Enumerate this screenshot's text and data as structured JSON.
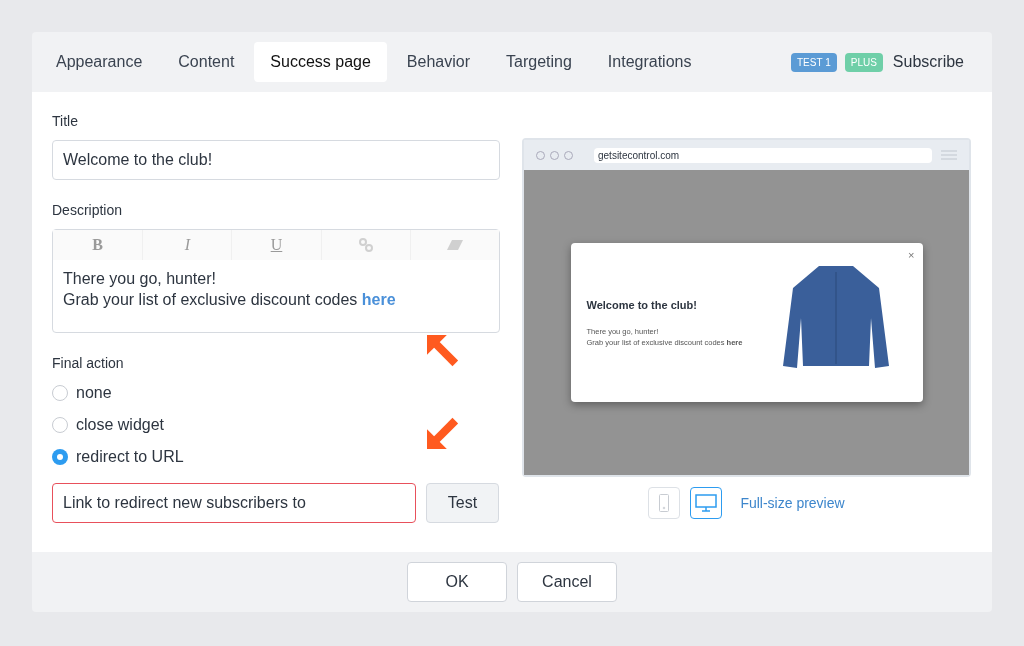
{
  "tabs": [
    {
      "label": "Appearance",
      "selected": false
    },
    {
      "label": "Content",
      "selected": false
    },
    {
      "label": "Success page",
      "selected": true
    },
    {
      "label": "Behavior",
      "selected": false
    },
    {
      "label": "Targeting",
      "selected": false
    },
    {
      "label": "Integrations",
      "selected": false
    }
  ],
  "header_right": {
    "badges": [
      {
        "text": "TEST 1",
        "color": "#5b9bd5"
      },
      {
        "text": "PLUS",
        "color": "#6fcfa8"
      }
    ],
    "label": "Subscribe"
  },
  "title_field": {
    "label": "Title",
    "value": "Welcome to the club!"
  },
  "description": {
    "label": "Description",
    "toolbar": [
      "B",
      "I",
      "U"
    ],
    "lines": [
      "There you go, hunter!",
      "Grab your list of exclusive discount codes **here**"
    ]
  },
  "final_action": {
    "label": "Final action",
    "options": [
      {
        "label": "none",
        "selected": false
      },
      {
        "label": "close widget",
        "selected": false
      },
      {
        "label": "redirect to URL",
        "selected": true
      }
    ]
  },
  "url_field": {
    "placeholder": "Link to redirect new subscribers to",
    "error": true
  },
  "test_button": "Test",
  "preview": {
    "url": "getsitecontrol.com",
    "popup_title": "Welcome to the club!",
    "popup_close": "×",
    "popup_lines": [
      "There you go, hunter!",
      "Grab your list of exclusive discount codes **here**"
    ],
    "devices": [
      {
        "kind": "mobile",
        "selected": false
      },
      {
        "kind": "desktop",
        "selected": true
      }
    ],
    "full_size_link": "Full-size preview"
  },
  "footer_buttons": [
    "OK",
    "Cancel"
  ]
}
